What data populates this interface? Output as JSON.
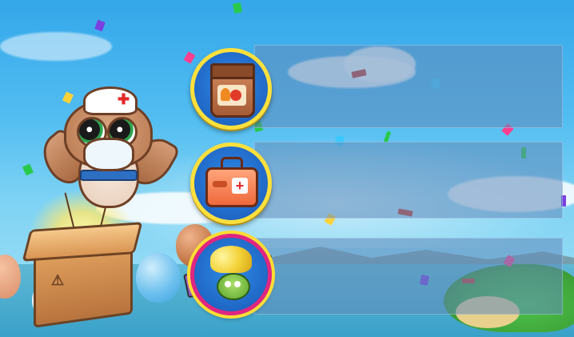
{
  "scene": {
    "background_colors": [
      "#34a7ea",
      "#7fd3f4",
      "#a6e2f6"
    ],
    "accent_badge_border": "#ffe03c"
  },
  "mascot": {
    "character": "nurse-owl",
    "cap_symbol": "✚",
    "box_marking": "⚠",
    "box_color": "#d99553"
  },
  "rows": [
    {
      "icon": "seed-bag-icon",
      "title": "",
      "description": ""
    },
    {
      "icon": "medical-kit-icon",
      "title": "",
      "description": "",
      "kit_symbol": "+"
    },
    {
      "icon": "gold-monster-bundle-icon",
      "title": "",
      "description": ""
    }
  ],
  "confetti_colors": [
    "#ff3f8e",
    "#3ac9ff",
    "#7a3fe0",
    "#ffd23a",
    "#28c94b",
    "#ff7a1a",
    "#c83a2a"
  ]
}
